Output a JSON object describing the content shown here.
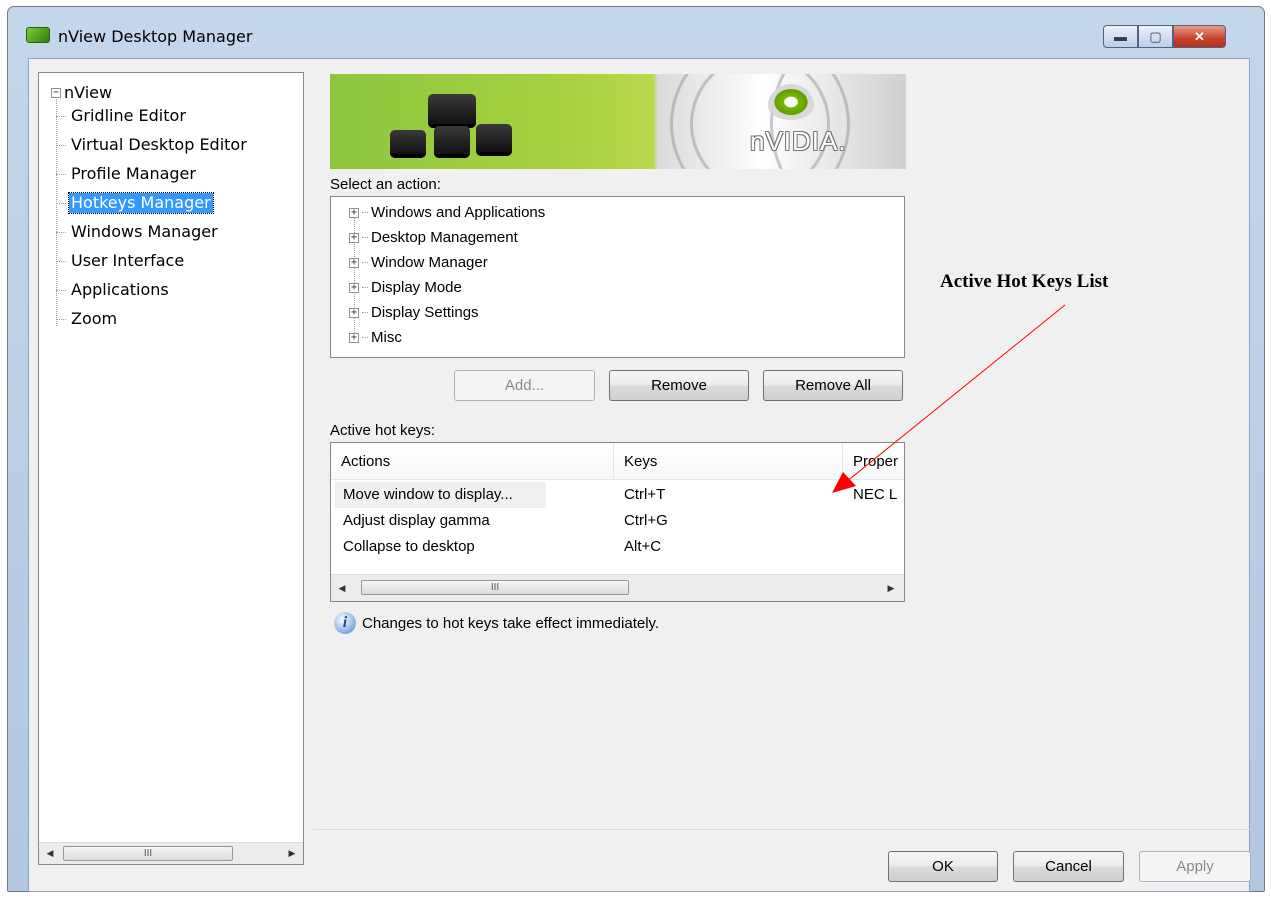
{
  "window": {
    "title": "nView Desktop Manager",
    "controls": {
      "minimize": "▬",
      "maximize": "▢",
      "close": "✕"
    }
  },
  "tree": {
    "root": "nView",
    "root_toggle": "−",
    "items": [
      {
        "label": "Gridline Editor",
        "selected": false
      },
      {
        "label": "Virtual Desktop Editor",
        "selected": false
      },
      {
        "label": "Profile Manager",
        "selected": false
      },
      {
        "label": "Hotkeys Manager",
        "selected": true
      },
      {
        "label": "Windows Manager",
        "selected": false
      },
      {
        "label": "User Interface",
        "selected": false
      },
      {
        "label": "Applications",
        "selected": false
      },
      {
        "label": "Zoom",
        "selected": false
      }
    ],
    "scroll_left": "◀",
    "scroll_right": "▶",
    "scroll_thumb": "III"
  },
  "banner": {
    "logo_text": "nVIDIA."
  },
  "actions": {
    "label": "Select an action:",
    "expand_glyph": "+",
    "items": [
      "Windows and Applications",
      "Desktop Management",
      "Window Manager",
      "Display Mode",
      "Display Settings",
      "Misc"
    ]
  },
  "buttons": {
    "add": "Add...",
    "remove": "Remove",
    "remove_all": "Remove All",
    "ok": "OK",
    "cancel": "Cancel",
    "apply": "Apply"
  },
  "hotkeys": {
    "label": "Active hot keys:",
    "columns": [
      "Actions",
      "Keys",
      "Proper"
    ],
    "rows": [
      {
        "action": "Move window to display...",
        "keys": "Ctrl+T",
        "property": "NEC L"
      },
      {
        "action": "Adjust display gamma",
        "keys": "Ctrl+G",
        "property": ""
      },
      {
        "action": "Collapse to desktop",
        "keys": "Alt+C",
        "property": ""
      }
    ],
    "scroll_left": "◀",
    "scroll_right": "▶",
    "scroll_thumb": "III"
  },
  "info": {
    "icon": "i",
    "text": "Changes to hot keys take effect immediately."
  },
  "annotation": {
    "text": "Active Hot Keys List",
    "color": "#ff0000"
  }
}
